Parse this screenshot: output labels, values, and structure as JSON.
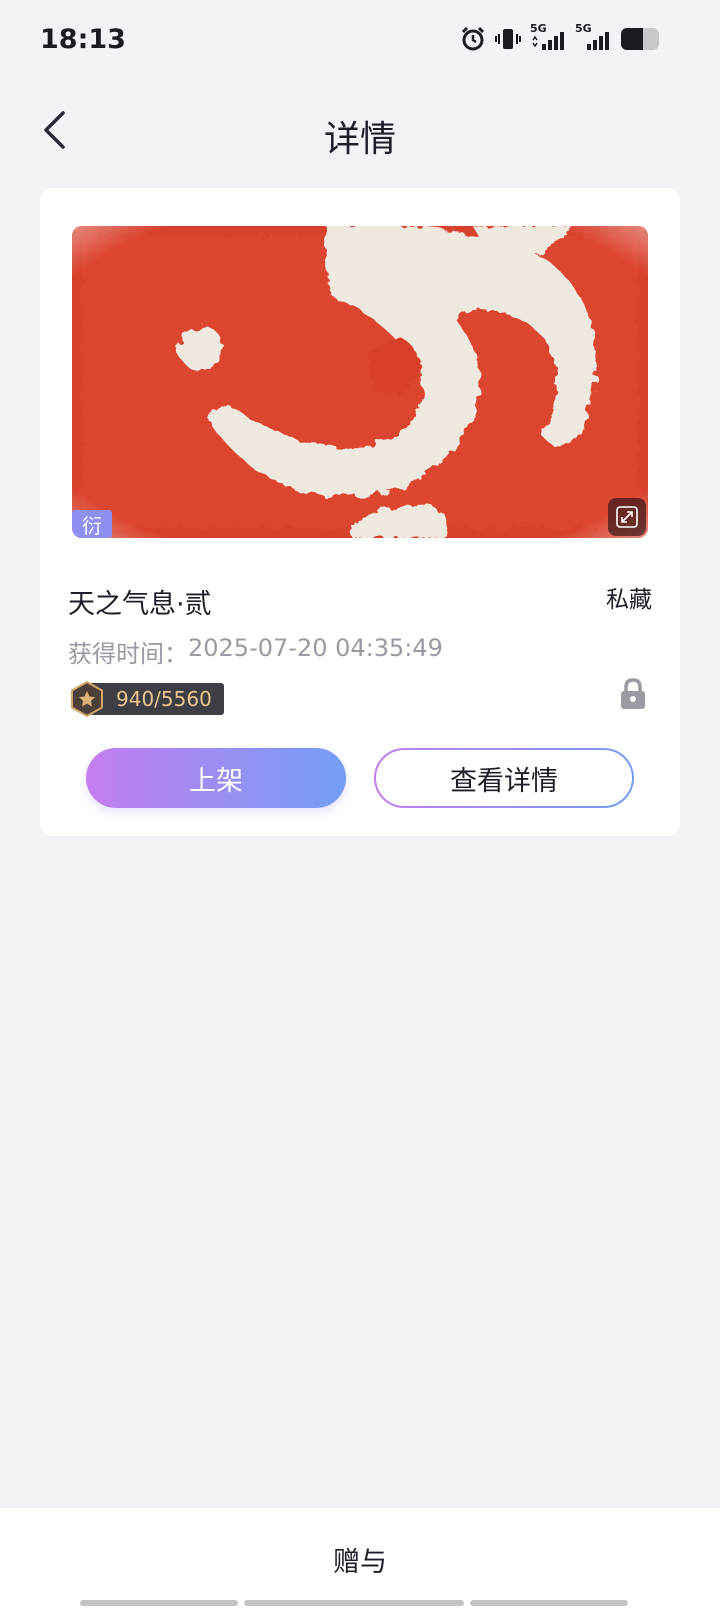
{
  "status_bar": {
    "time": "18:13",
    "network_1": "5G",
    "network_2": "5G",
    "icons": [
      "alarm-icon",
      "vibrate-icon",
      "signal-5g-icon",
      "signal-5g-icon",
      "battery-icon"
    ]
  },
  "header": {
    "title": "详情",
    "back_icon": "chevron-left-icon"
  },
  "item": {
    "edition_tag": "衍",
    "name": "天之气息·贰",
    "privacy": "私藏",
    "acquired_label": "获得时间：",
    "acquired_time": "2025-07-20 04:35:49",
    "serial": "940/5560",
    "locked": true
  },
  "actions": {
    "list_label": "上架",
    "view_label": "查看详情"
  },
  "bottom": {
    "gift_label": "赠与"
  },
  "colors": {
    "background": "#f2f3f7",
    "gradient_start": "#c47df0",
    "gradient_end": "#739ef5",
    "artwork_red": "#d8412c",
    "serial_text": "#e8c48f"
  }
}
